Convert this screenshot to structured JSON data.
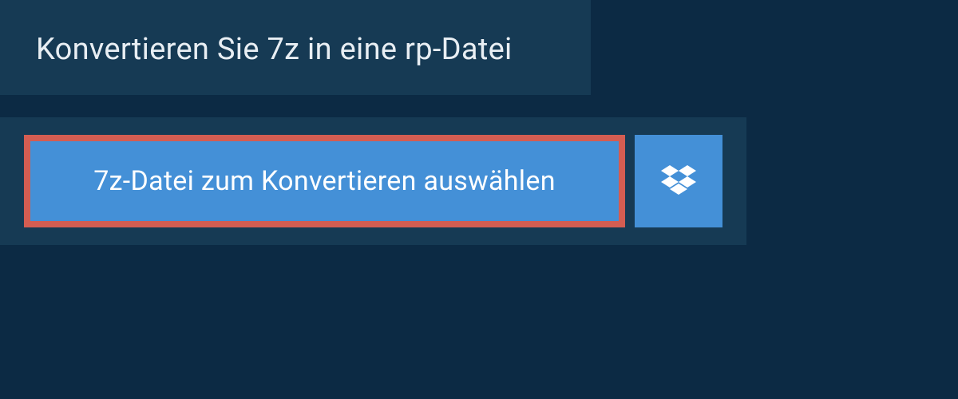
{
  "header": {
    "title": "Konvertieren Sie 7z in eine rp-Datei"
  },
  "actions": {
    "select_file_label": "7z-Datei zum Konvertieren auswählen",
    "dropbox_icon_name": "dropbox"
  },
  "colors": {
    "background": "#0c2a44",
    "panel": "#163a54",
    "button": "#4490d7",
    "highlight_border": "#d45d52",
    "text_light": "#e8eef3",
    "text_white": "#ffffff"
  }
}
